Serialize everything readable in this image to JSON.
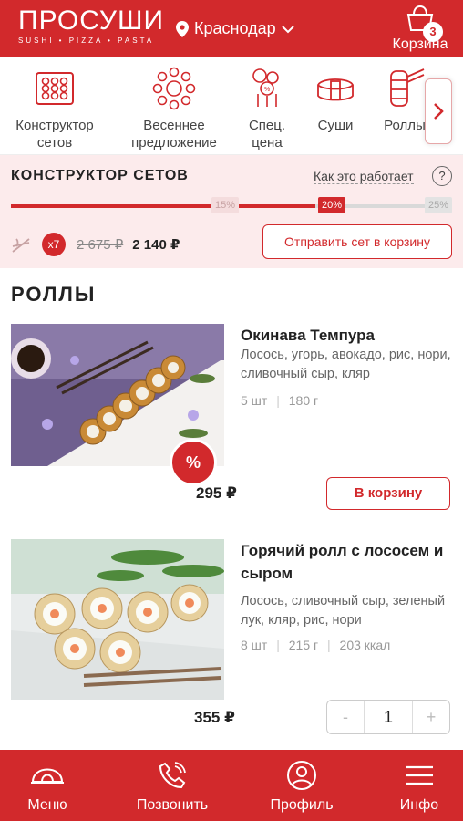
{
  "colors": {
    "brand": "#d2292c",
    "tint": "#fcebec"
  },
  "header": {
    "logo": "ПРОСУШИ",
    "logo_sub": "SUSHI • PIZZA • PASTA",
    "city": "Краснодар",
    "cart_label": "Корзина",
    "cart_count": "3"
  },
  "categories": [
    {
      "label_1": "Конструктор",
      "label_2": "сетов",
      "icon": "set-builder-icon"
    },
    {
      "label_1": "Весеннее",
      "label_2": "предложение",
      "icon": "spring-offer-icon"
    },
    {
      "label_1": "Спец.",
      "label_2": "цена",
      "icon": "special-price-icon"
    },
    {
      "label_1": "Суши",
      "label_2": "",
      "icon": "sushi-icon"
    },
    {
      "label_1": "Роллы",
      "label_2": "",
      "icon": "rolls-icon"
    }
  ],
  "constructor": {
    "title": "КОНСТРУКТОР СЕТОВ",
    "how_link": "Как это работает",
    "help": "?",
    "progress": 0.69,
    "marks": [
      "15%",
      "20%",
      "25%"
    ],
    "multiplier": "x7",
    "old_price": "2 675 ₽",
    "new_price": "2 140 ₽",
    "send_button": "Отправить сет в корзину"
  },
  "section_title": "РОЛЛЫ",
  "products": [
    {
      "name": "Окинава Темпура",
      "desc": "Лосось, угорь, авокадо, рис, нори, сливочный сыр, кляр",
      "pieces": "5 шт",
      "weight": "180 г",
      "price": "295 ₽",
      "button": "В корзину",
      "promo": "%"
    },
    {
      "name": "Горячий ролл с лососем и сыром",
      "desc": "Лосось, сливочный сыр, зеленый лук, кляр, рис, нори",
      "pieces": "8 шт",
      "weight": "215 г",
      "kcal": "203 ккал",
      "price": "355 ₽",
      "minus": "-",
      "qty": "1",
      "plus": "+"
    }
  ],
  "bottom_nav": [
    {
      "label": "Меню",
      "icon": "menu-roll-icon"
    },
    {
      "label": "Позвонить",
      "icon": "phone-icon"
    },
    {
      "label": "Профиль",
      "icon": "profile-icon"
    },
    {
      "label": "Инфо",
      "icon": "info-lines-icon"
    }
  ]
}
